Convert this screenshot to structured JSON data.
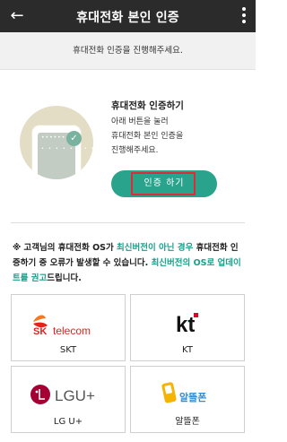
{
  "appbar": {
    "title": "휴대전화 본인 인증",
    "back_icon": "arrow-left",
    "more_icon": "more-vertical"
  },
  "notice": "휴대전화 인증을 진행해주세요.",
  "auth": {
    "title": "휴대전화 인증하기",
    "description_lines": [
      "아래 버튼을 눌러",
      "휴대전화 본인 인증을",
      "진행해주세요."
    ],
    "button_label": "인증 하기"
  },
  "warning": {
    "part1": "※ 고객님의 휴대전화 OS가 ",
    "highlight1": "최신버전이 아닌 경우",
    "part2": " 휴대전화 인증하기 중 오류가 발생할 수 있습니다. ",
    "highlight2": "최신버전의 OS로 업데이트를 권고",
    "part3": "드립니다."
  },
  "carriers": [
    {
      "label": "SKT",
      "logo_text": "telecom",
      "logo_mark": "SK"
    },
    {
      "label": "KT",
      "logo_mark": "kt"
    },
    {
      "label": "LG U+",
      "logo_text": "LGU+"
    },
    {
      "label": "알뜰폰",
      "logo_text": "알뜰폰"
    }
  ],
  "colors": {
    "appbar": "#2b2b2b",
    "accent": "#2aa38c",
    "highlight_border": "#e02a3a",
    "sk_red": "#e2231a",
    "sk_orange": "#f47920",
    "kt_red": "#e4002b",
    "lg_magenta": "#a50034"
  }
}
